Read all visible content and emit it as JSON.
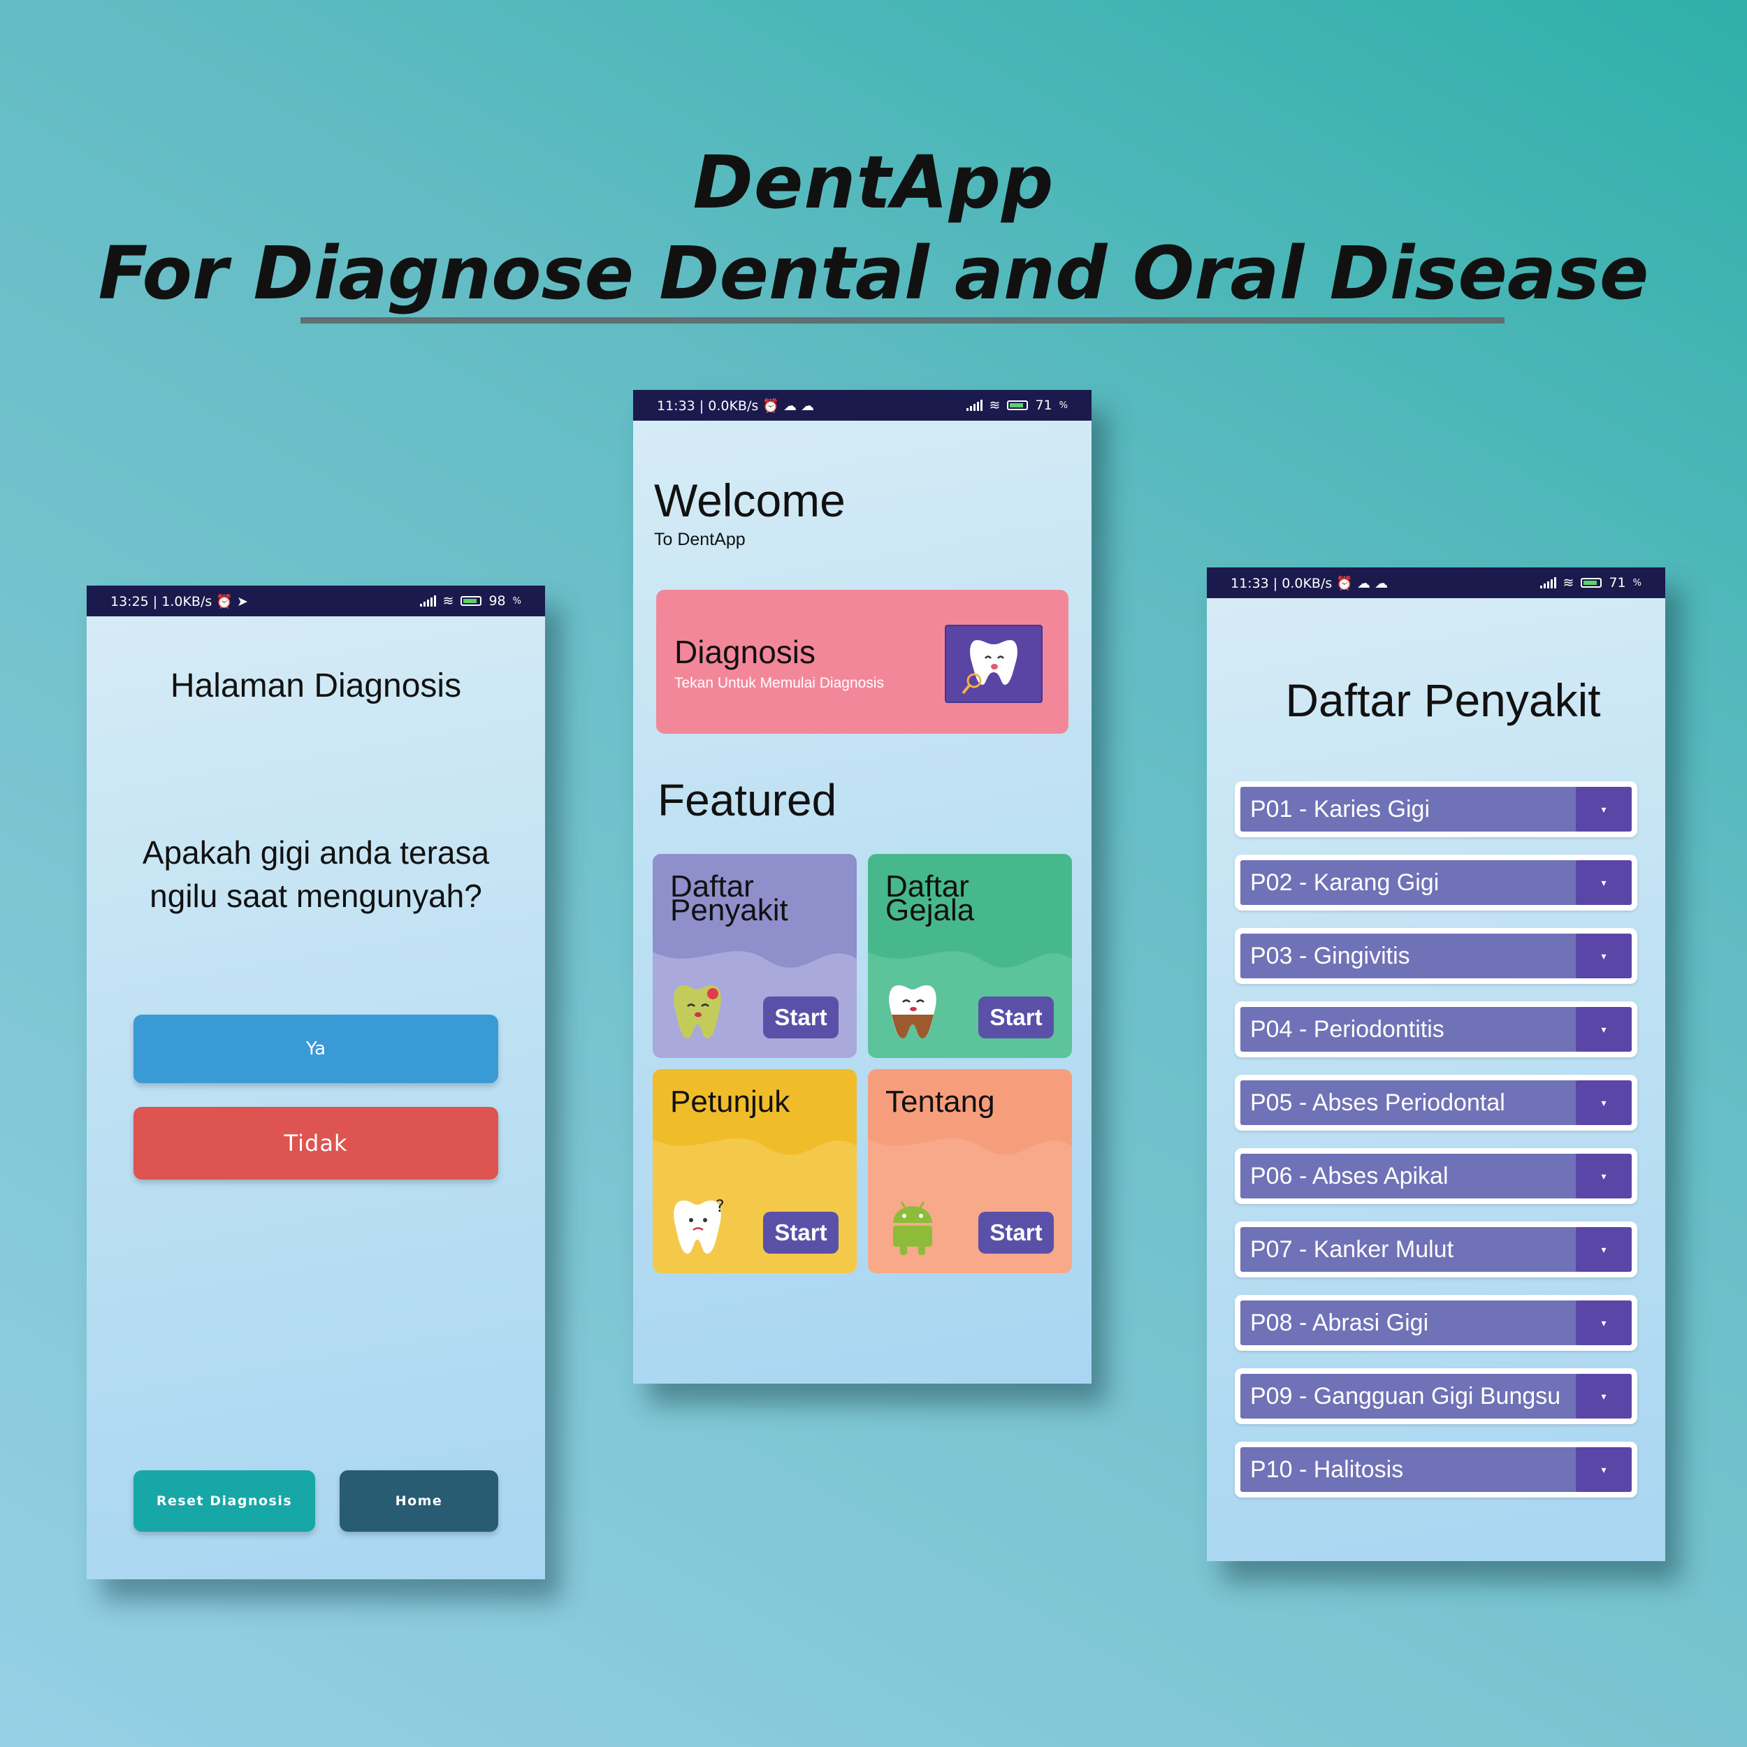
{
  "title": {
    "line1": "DentApp",
    "line2": "For Diagnose Dental and Oral Disease"
  },
  "screen_diagnosis": {
    "status": {
      "left": "13:25 | 1.0KB/s",
      "battery": "98"
    },
    "title": "Halaman Diagnosis",
    "question": "Apakah gigi anda terasa ngilu saat mengunyah?",
    "yes_label": "Ya",
    "no_label": "Tidak",
    "reset_label": "Reset Diagnosis",
    "home_label": "Home"
  },
  "screen_home": {
    "status": {
      "left": "11:33 | 0.0KB/s",
      "battery": "71"
    },
    "welcome": "Welcome",
    "welcome_sub": "To DentApp",
    "diagnosis_card": {
      "title": "Diagnosis",
      "subtitle": "Tekan Untuk Memulai Diagnosis"
    },
    "featured_title": "Featured",
    "cards": [
      {
        "line1": "Daftar",
        "line2": "Penyakit",
        "start": "Start",
        "color": "#a9a9dc",
        "icon": "tooth-decay-icon"
      },
      {
        "line1": "Daftar",
        "line2": "Gejala",
        "start": "Start",
        "color": "#5cc39a",
        "icon": "tooth-roots-icon"
      },
      {
        "line1": "Petunjuk",
        "line2": "",
        "start": "Start",
        "color": "#f4c94a",
        "icon": "tooth-question-icon"
      },
      {
        "line1": "Tentang",
        "line2": "",
        "start": "Start",
        "color": "#f8a98a",
        "icon": "android-icon"
      }
    ]
  },
  "screen_diseases": {
    "status": {
      "left": "11:33 | 0.0KB/s",
      "battery": "71"
    },
    "title": "Daftar Penyakit",
    "items": [
      "P01 - Karies Gigi",
      "P02 - Karang Gigi",
      "P03 - Gingivitis",
      "P04 - Periodontitis",
      "P05 - Abses Periodontal",
      "P06 - Abses Apikal",
      "P07 - Kanker Mulut",
      "P08 - Abrasi Gigi",
      "P09 - Gangguan Gigi Bungsu",
      "P10 - Halitosis"
    ]
  },
  "colors": {
    "status_bar": "#1b1a4d",
    "yes": "#3a9ad6",
    "no": "#de5450",
    "reset": "#18a7a7",
    "home": "#275c73",
    "diagnosis_card": "#f3879a",
    "list_bar": "#6f72b6",
    "list_dropdown": "#5a46a6"
  }
}
